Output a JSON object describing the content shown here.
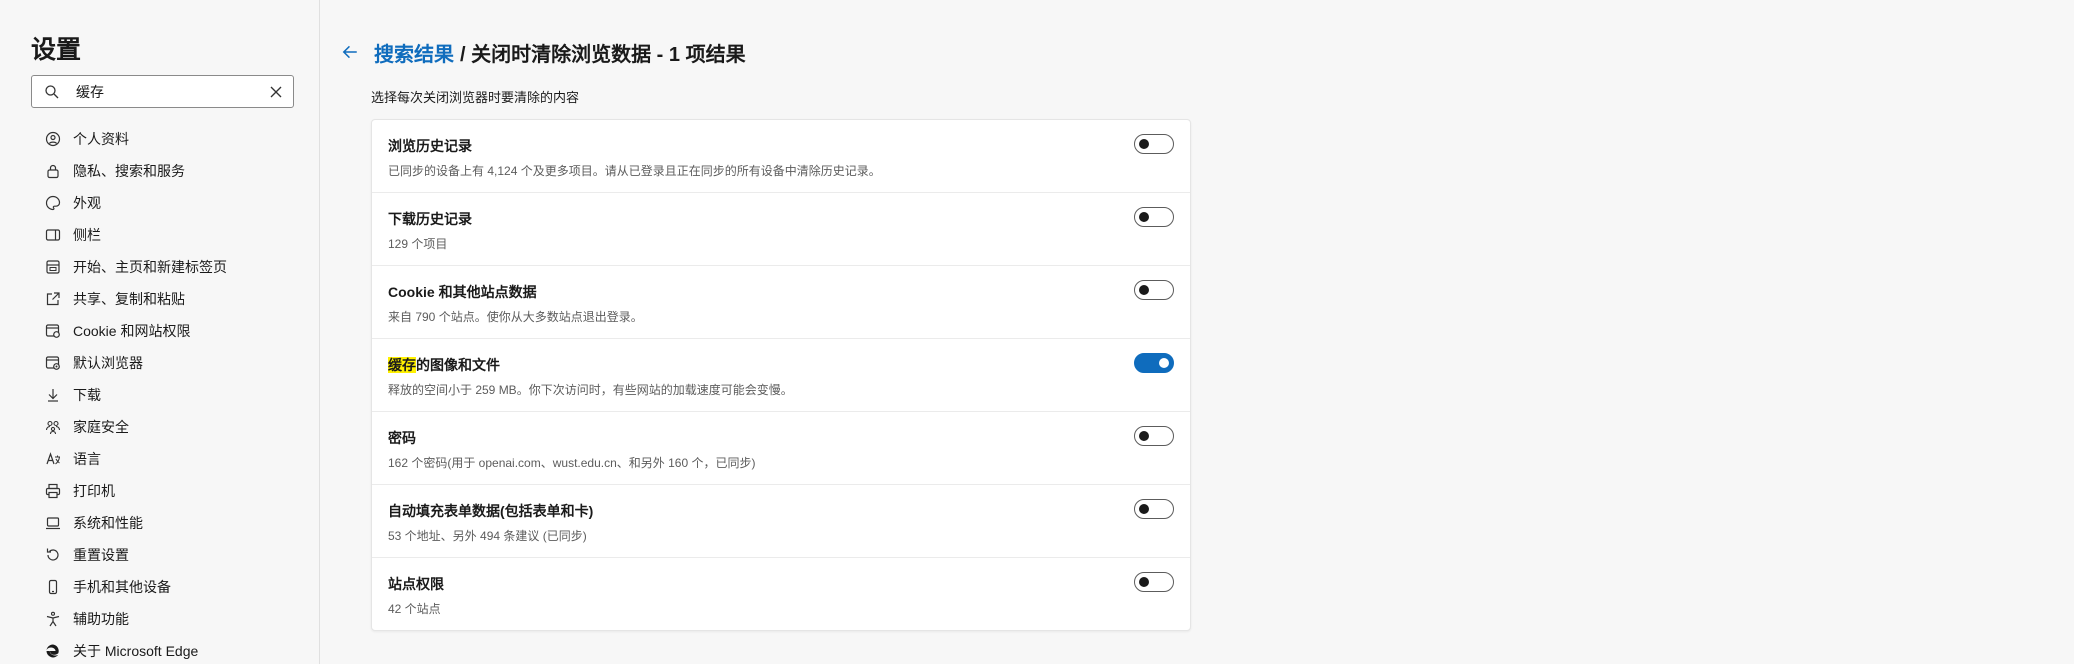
{
  "sidebar": {
    "title": "设置",
    "search": {
      "value": "缓存",
      "placeholder": ""
    },
    "items": [
      {
        "label": "个人资料",
        "icon": "profile-icon"
      },
      {
        "label": "隐私、搜索和服务",
        "icon": "lock-icon"
      },
      {
        "label": "外观",
        "icon": "palette-icon"
      },
      {
        "label": "侧栏",
        "icon": "sidebar-icon"
      },
      {
        "label": "开始、主页和新建标签页",
        "icon": "home-icon"
      },
      {
        "label": "共享、复制和粘贴",
        "icon": "share-icon"
      },
      {
        "label": "Cookie 和网站权限",
        "icon": "site-permissions-icon"
      },
      {
        "label": "默认浏览器",
        "icon": "browser-icon"
      },
      {
        "label": "下载",
        "icon": "download-icon"
      },
      {
        "label": "家庭安全",
        "icon": "family-icon"
      },
      {
        "label": "语言",
        "icon": "language-icon"
      },
      {
        "label": "打印机",
        "icon": "printer-icon"
      },
      {
        "label": "系统和性能",
        "icon": "laptop-icon"
      },
      {
        "label": "重置设置",
        "icon": "reset-icon"
      },
      {
        "label": "手机和其他设备",
        "icon": "phone-icon"
      },
      {
        "label": "辅助功能",
        "icon": "accessibility-icon"
      },
      {
        "label": "关于 Microsoft Edge",
        "icon": "edge-icon"
      }
    ]
  },
  "header": {
    "link": "搜索结果",
    "rest": "/ 关闭时清除浏览数据 - 1 项结果"
  },
  "subtitle": "选择每次关闭浏览器时要清除的内容",
  "options": [
    {
      "title": "浏览历史记录",
      "desc": "已同步的设备上有 4,124 个及更多项目。请从已登录且正在同步的所有设备中清除历史记录。",
      "on": false
    },
    {
      "title": "下载历史记录",
      "desc": "129 个项目",
      "on": false
    },
    {
      "title": "Cookie 和其他站点数据",
      "desc": "来自 790 个站点。使你从大多数站点退出登录。",
      "on": false
    },
    {
      "title_highlight": "缓存",
      "title": "的图像和文件",
      "desc": "释放的空间小于 259 MB。你下次访问时，有些网站的加载速度可能会变慢。",
      "on": true
    },
    {
      "title": "密码",
      "desc": "162 个密码(用于 openai.com、wust.edu.cn、和另外 160 个，已同步)",
      "on": false
    },
    {
      "title": "自动填充表单数据(包括表单和卡)",
      "desc": "53 个地址、另外 494 条建议 (已同步)",
      "on": false
    },
    {
      "title": "站点权限",
      "desc": "42 个站点",
      "on": false
    }
  ],
  "colors": {
    "accent": "#0f6cbd",
    "highlight": "#fff100"
  }
}
